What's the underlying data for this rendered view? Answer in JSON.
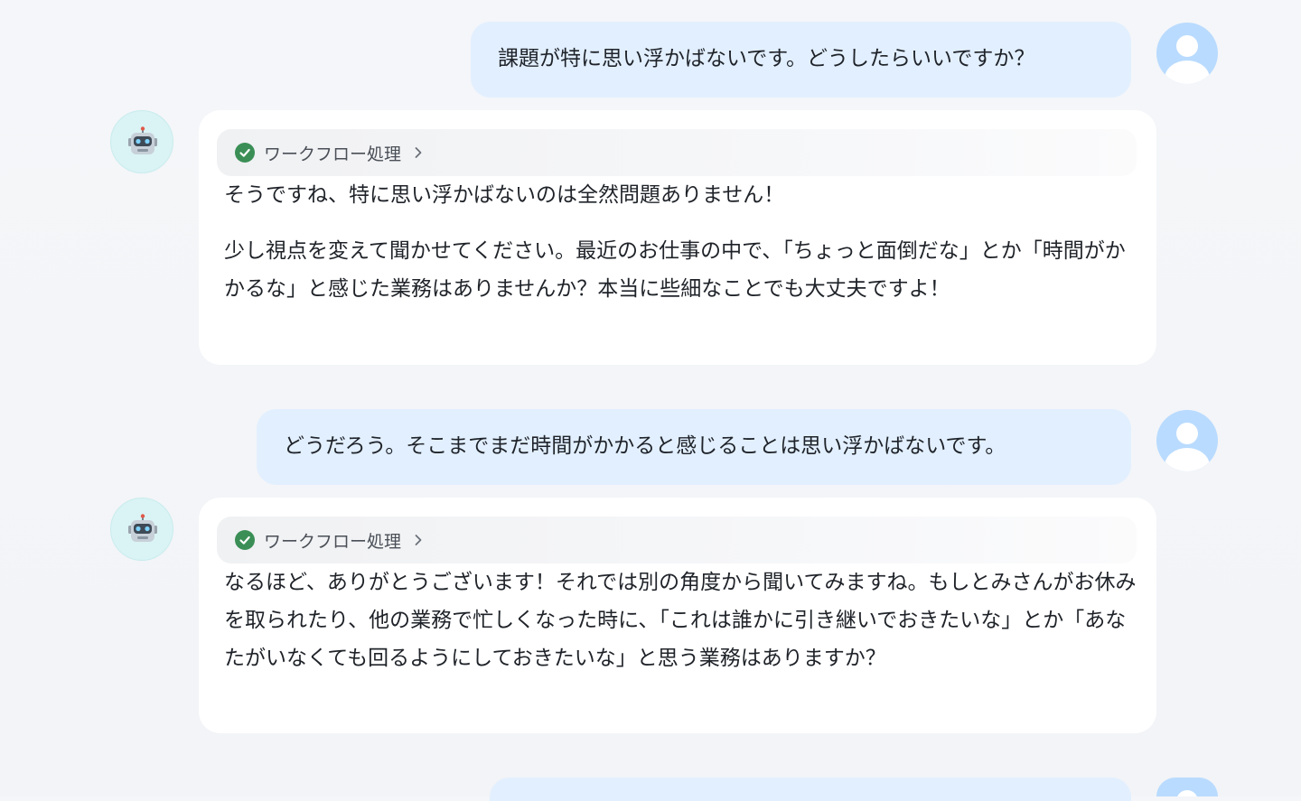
{
  "messages": [
    {
      "role": "user",
      "text": "課題が特に思い浮かばないです。どうしたらいいですか？"
    },
    {
      "role": "assistant",
      "workflow_label": "ワークフロー処理",
      "paragraphs": [
        "そうですね、特に思い浮かばないのは全然問題ありません！",
        "少し視点を変えて聞かせてください。最近のお仕事の中で、「ちょっと面倒だな」とか「時間がかかるな」と感じた業務はありませんか？本当に些細なことでも大丈夫ですよ！"
      ]
    },
    {
      "role": "user",
      "text": "どうだろう。そこまでまだ時間がかかると感じることは思い浮かばないです。"
    },
    {
      "role": "assistant",
      "workflow_label": "ワークフロー処理",
      "paragraphs": [
        "なるほど、ありがとうございます！それでは別の角度から聞いてみますね。もしとみさんがお休みを取られたり、他の業務で忙しくなった時に、「これは誰かに引き継いでおきたいな」とか「あなたがいなくても回るようにしておきたいな」と思う業務はありますか？"
      ]
    },
    {
      "role": "user",
      "text": ""
    }
  ],
  "colors": {
    "user_bubble": "#e2efff",
    "assistant_card": "#ffffff",
    "check_green": "#3b8f56",
    "user_avatar": "#b9dbff",
    "bot_avatar_bg": "#daf3f4"
  },
  "icons": {
    "user_avatar": "user-avatar-icon",
    "bot_avatar": "robot-icon",
    "workflow_status": "check-circle-icon",
    "workflow_expand": "chevron-right-icon"
  }
}
